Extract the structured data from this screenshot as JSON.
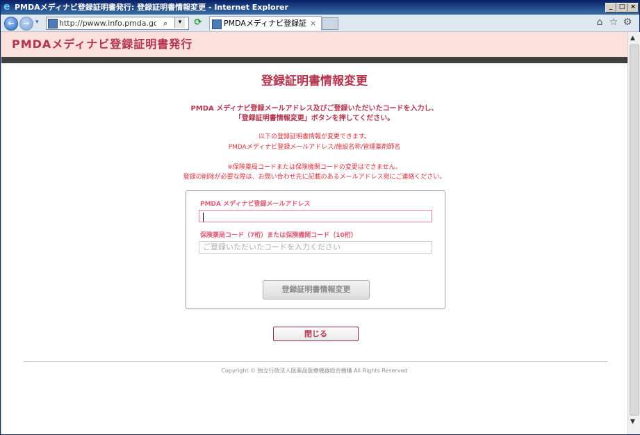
{
  "window": {
    "title": "PMDAメディナビ登録証明書発行: 登録証明書情報変更 - Internet Explorer",
    "minimize": "_",
    "maximize": "□",
    "close": "×"
  },
  "browser": {
    "back": "←",
    "forward": "→",
    "url": "http://pwww.info.pmda.go.jp/push/Certi",
    "search_glyph": "⌕",
    "dropdown_glyph": "▾",
    "refresh_glyph": "⟳",
    "tab_label": "PMDAメディナビ登録証明書...",
    "tab_close": "×",
    "home_glyph": "⌂",
    "favorites_glyph": "☆",
    "tools_glyph": "⚙",
    "colors": {
      "titlebar": "#0a246a",
      "chrome": "#dfe7f0"
    }
  },
  "site": {
    "header_title": "PMDAメディナビ登録証明書発行",
    "accent_color": "#b3344c",
    "header_bg": "#fbe0dc"
  },
  "page": {
    "title": "登録証明書情報変更",
    "instruction_line1": "PMDA メディナビ登録メールアドレス及びご登録いただいたコードを入力し、",
    "instruction_line2": "「登録証明書情報変更」ボタンを押してください。",
    "note_line1": "以下の登録証明書情報が変更できます。",
    "note_line2": "PMDAメディナビ登録メールアドレス/施設名称/管理薬剤師名",
    "note_line3": "※保険薬局コードまたは保険機関コードの変更はできません。",
    "note_line4": "登録の削除が必要な際は、お問い合わせ先に記載のあるメールアドレス宛にご連絡ください。"
  },
  "form": {
    "email_label": "PMDA メディナビ登録メールアドレス",
    "email_value": "",
    "code_label": "保険薬局コード（7桁）または保険機関コード（10桁）",
    "code_placeholder": "ご登録いただいたコードを入力ください",
    "submit_label": "登録証明書情報変更"
  },
  "close_label": "閉じる",
  "footer": {
    "copyright": "Copyright © 独立行政法人医薬品医療機器総合機構 All Rights Reserved"
  },
  "scrollbar": {
    "up": "▲",
    "down": "▼"
  }
}
